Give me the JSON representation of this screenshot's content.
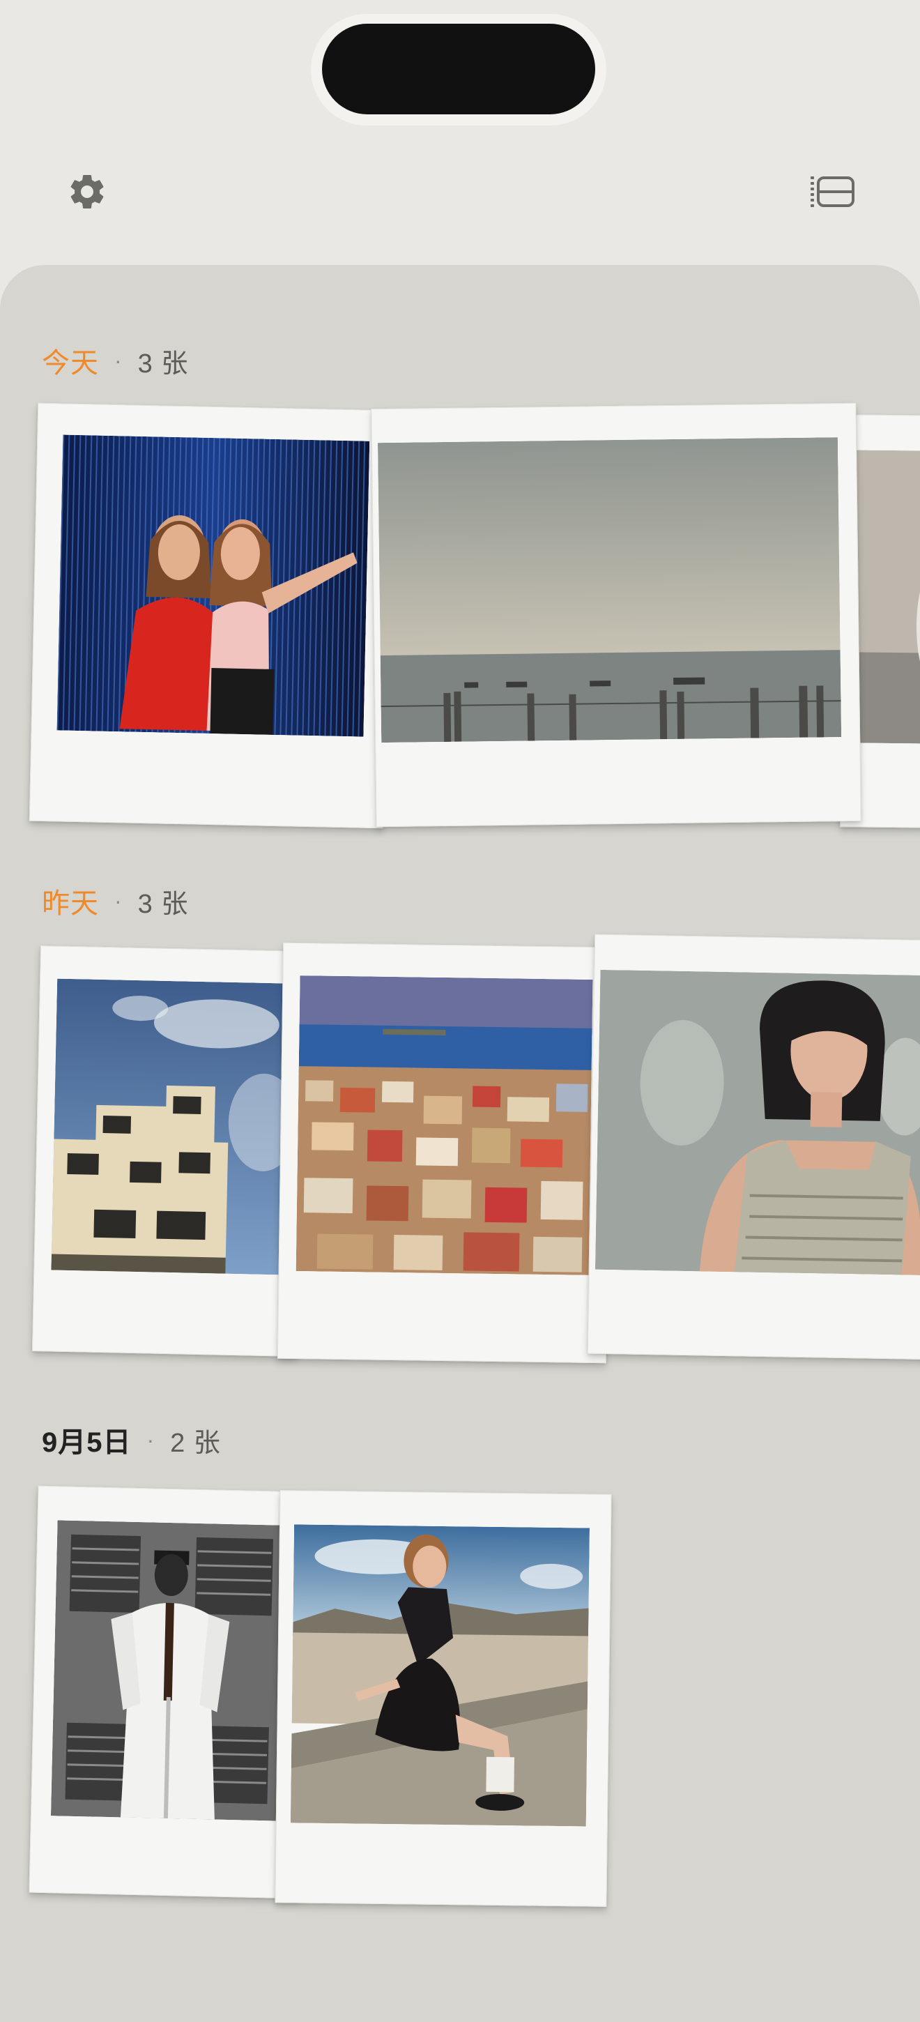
{
  "header": {
    "settings_icon": "gear-icon",
    "layout_icon": "stack-layout-icon"
  },
  "sections": [
    {
      "title": "今天",
      "separator": "·",
      "count": "3 张"
    },
    {
      "title": "昨天",
      "separator": "·",
      "count": "3 张"
    },
    {
      "title": "9月5日",
      "separator": "·",
      "count": "2 张"
    }
  ],
  "colors": {
    "accent": "#ef8a2c",
    "background": "#e9e8e4",
    "panel": "#d6d5cf",
    "polaroid_frame": "#f6f6f4"
  }
}
